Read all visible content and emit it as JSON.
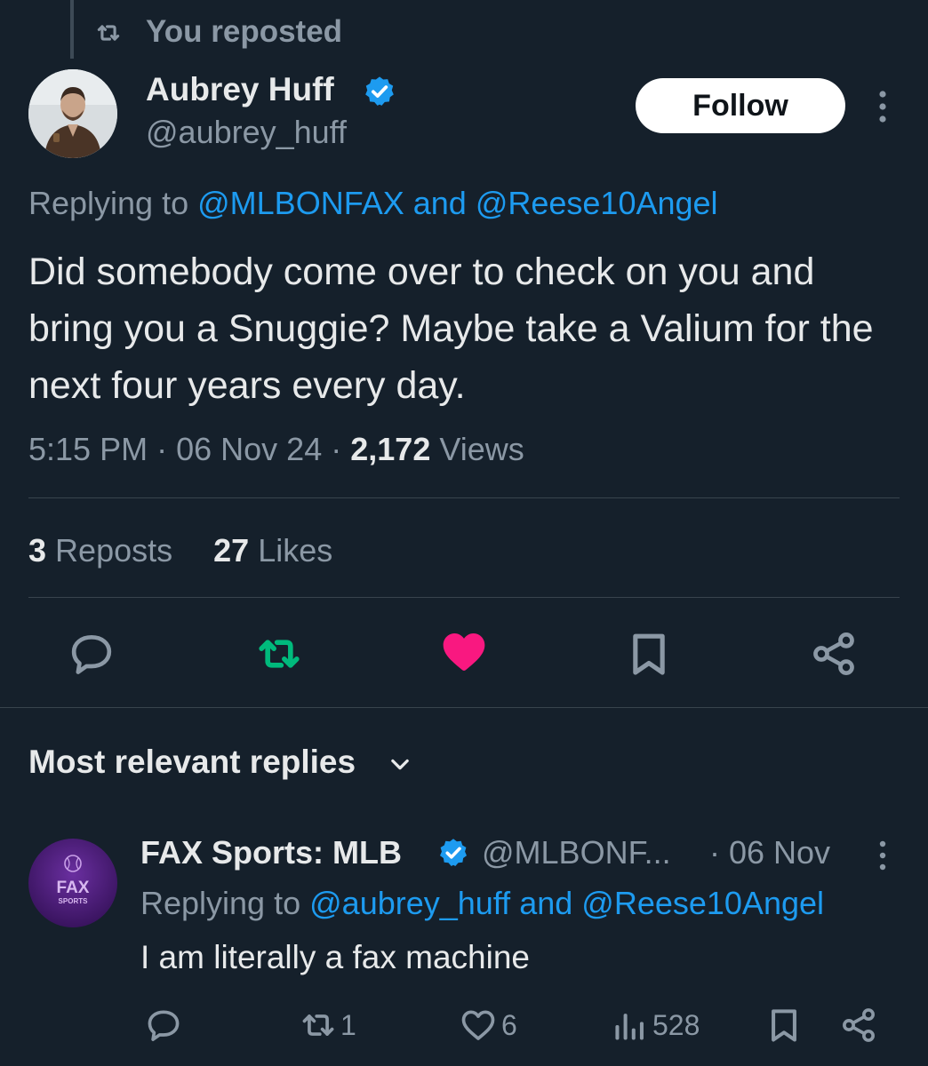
{
  "repost_header": {
    "text": "You reposted"
  },
  "tweet": {
    "author_name": "Aubrey Huff",
    "author_handle": "@aubrey_huff",
    "follow_label": "Follow",
    "replying_prefix": "Replying to",
    "replying_mention_1": "@MLBONFAX",
    "replying_and": "and",
    "replying_mention_2": "@Reese10Angel",
    "body": "Did somebody come over to check on you and bring you a Snuggie? Maybe take a Valium for the next four years every day.",
    "time": "5:15 PM",
    "date": "06 Nov 24",
    "views_count": "2,172",
    "views_label": "Views",
    "reposts_count": "3",
    "reposts_label": "Reposts",
    "likes_count": "27",
    "likes_label": "Likes",
    "liked": true,
    "reposted": true
  },
  "replies_section": {
    "title": "Most relevant replies"
  },
  "reply": {
    "author_name": "FAX Sports: MLB",
    "author_handle": "@MLBONF...",
    "date": "· 06 Nov",
    "replying_prefix": "Replying to",
    "replying_mention_1": "@aubrey_huff",
    "replying_and": "and",
    "replying_mention_2": "@Reese10Angel",
    "body": "I am literally a fax machine",
    "repost_count": "1",
    "like_count": "6",
    "view_count": "528",
    "avatar_text_1": "FAX",
    "avatar_text_2": "SPORTS"
  },
  "colors": {
    "background": "#15202b",
    "accent": "#1d9bf0",
    "repost_green": "#00ba7c",
    "like_pink": "#f91880",
    "muted": "#8b98a5"
  }
}
